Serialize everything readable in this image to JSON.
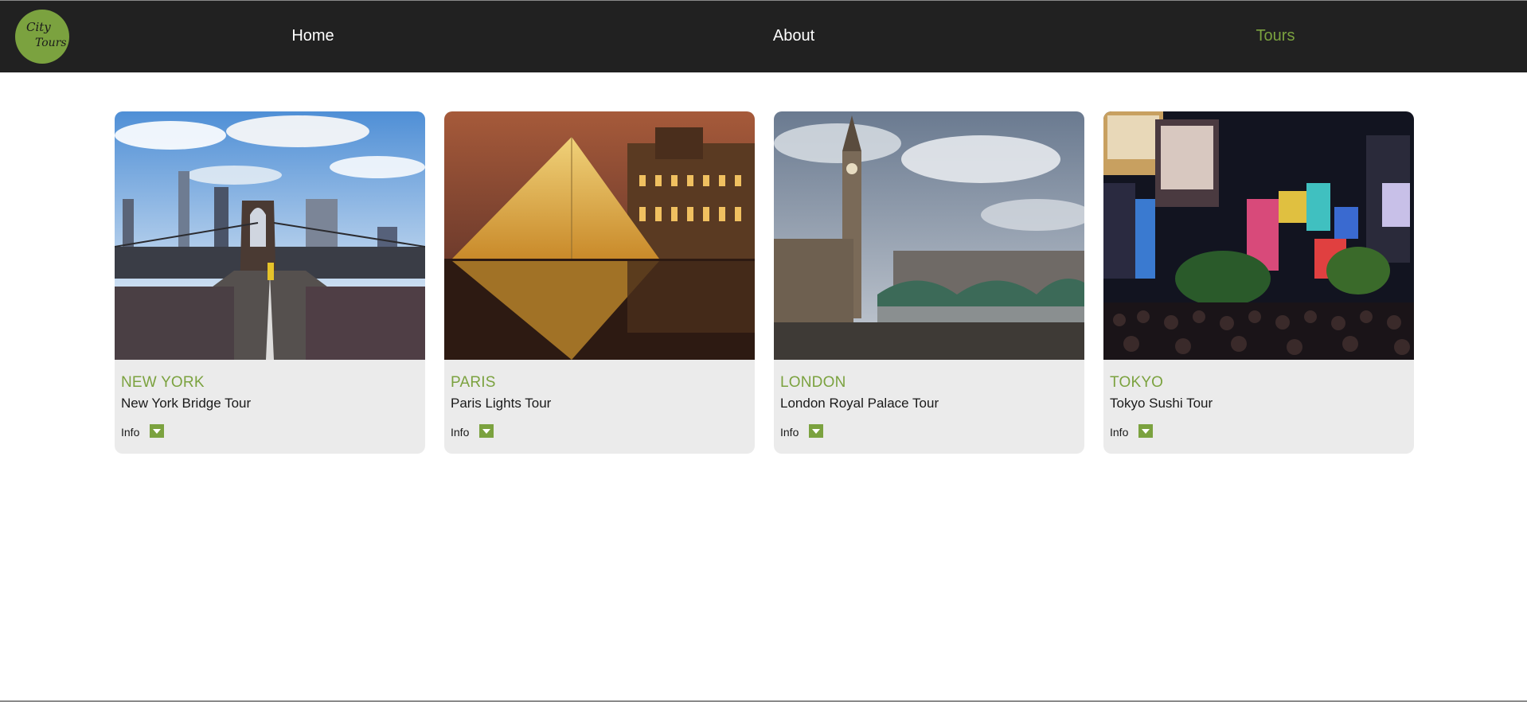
{
  "logo": {
    "line1": "City",
    "line2": "Tours"
  },
  "nav": {
    "items": [
      {
        "label": "Home",
        "active": false
      },
      {
        "label": "About",
        "active": false
      },
      {
        "label": "Tours",
        "active": true
      }
    ]
  },
  "tours": [
    {
      "city": "NEW YORK",
      "tour": "New York Bridge Tour",
      "info_label": "Info"
    },
    {
      "city": "PARIS",
      "tour": "Paris Lights Tour",
      "info_label": "Info"
    },
    {
      "city": "LONDON",
      "tour": "London Royal Palace Tour",
      "info_label": "Info"
    },
    {
      "city": "TOKYO",
      "tour": "Tokyo Sushi Tour",
      "info_label": "Info"
    }
  ],
  "colors": {
    "accent": "#7ba23f",
    "navbar": "#212121",
    "card": "#ebebeb"
  },
  "icons": {
    "info_toggle": "caret-down-icon"
  }
}
